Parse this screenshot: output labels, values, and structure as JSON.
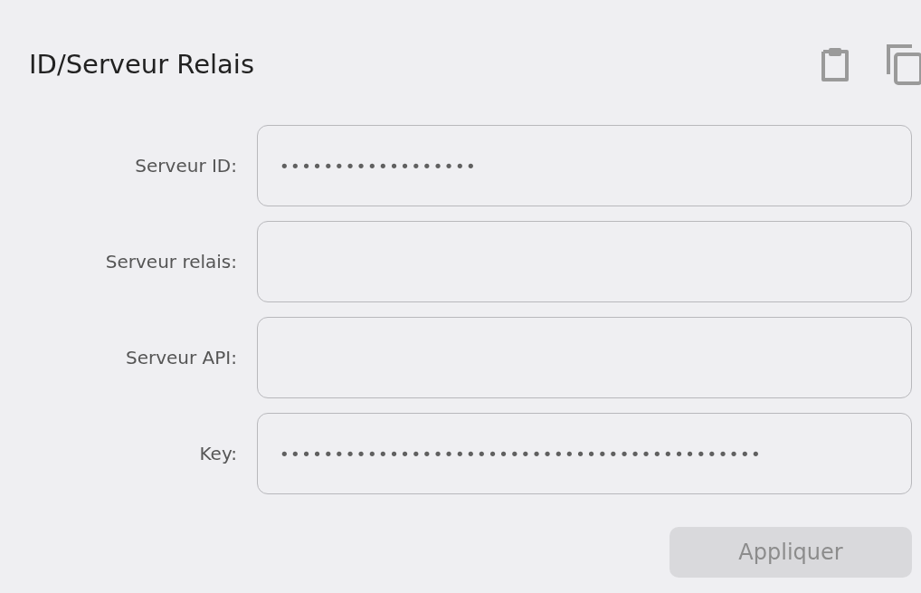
{
  "title": "ID/Serveur Relais",
  "fields": [
    {
      "label": "Serveur ID:",
      "value": "••••••••••••••••••"
    },
    {
      "label": "Serveur relais:"
    },
    {
      "label": "Serveur API:"
    },
    {
      "label": "Key:",
      "value": "••••••••••••••••••••••••••••••••••••••••••••"
    }
  ],
  "apply_button": {
    "label": "Appliquer",
    "disabled": true
  }
}
